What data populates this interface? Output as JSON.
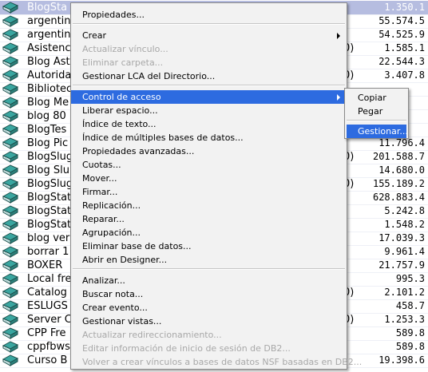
{
  "list": {
    "rows": [
      {
        "name": "BlogSta",
        "extra": "",
        "size": "1.350.1"
      },
      {
        "name": "argentin",
        "extra": "",
        "size": "55.574.5"
      },
      {
        "name": "argentin",
        "extra": "",
        "size": "54.525.9"
      },
      {
        "name": "Asistenc",
        "extra": "0)",
        "size": "1.585.1"
      },
      {
        "name": "Blog Ast",
        "extra": "",
        "size": "22.544.3"
      },
      {
        "name": "Autorida",
        "extra": "0)",
        "size": "3.407.8"
      },
      {
        "name": "Bibliotec",
        "extra": "",
        "size": ""
      },
      {
        "name": "Blog Me",
        "extra": "",
        "size": ""
      },
      {
        "name": "blog 80",
        "extra": "",
        "size": ""
      },
      {
        "name": "BlogTes",
        "extra": "",
        "size": ""
      },
      {
        "name": "Blog Pic",
        "extra": "",
        "size": "11.796.4"
      },
      {
        "name": "BlogSlug",
        "extra": "0)",
        "size": "201.588.7"
      },
      {
        "name": "Blog Slu",
        "extra": "",
        "size": "14.680.0"
      },
      {
        "name": "BlogSlug",
        "extra": "0)",
        "size": "155.189.2"
      },
      {
        "name": "BlogStat",
        "extra": "",
        "size": "628.883.4"
      },
      {
        "name": "BlogStat",
        "extra": "",
        "size": "5.242.8"
      },
      {
        "name": "BlogStat",
        "extra": "",
        "size": "1.548.2"
      },
      {
        "name": "blog ver",
        "extra": "",
        "size": "17.039.3"
      },
      {
        "name": "borrar 1",
        "extra": "",
        "size": "9.961.4"
      },
      {
        "name": "BOXER",
        "extra": "",
        "size": "21.757.9"
      },
      {
        "name": "Local fre",
        "extra": "",
        "size": "995.3"
      },
      {
        "name": "Catalog",
        "extra": "0)",
        "size": "2.101.2"
      },
      {
        "name": "ESLUGS",
        "extra": "",
        "size": "458.7"
      },
      {
        "name": "Server C",
        "extra": "0)",
        "size": "1.253.3"
      },
      {
        "name": "CPP Fre",
        "extra": "",
        "size": "589.8"
      },
      {
        "name": "cppfbws",
        "extra": "",
        "size": "589.8"
      },
      {
        "name": "Curso B",
        "extra": "",
        "size": "19.398.6"
      }
    ]
  },
  "context_menu": {
    "items": [
      {
        "label": "Propiedades...",
        "disabled": false
      },
      {
        "label": "Crear",
        "disabled": false,
        "submenu": true
      },
      {
        "label": "Actualizar vínculo...",
        "disabled": true
      },
      {
        "label": "Eliminar carpeta...",
        "disabled": true
      },
      {
        "label": "Gestionar LCA del Directorio...",
        "disabled": false
      },
      {
        "label": "Control de acceso",
        "disabled": false,
        "submenu": true,
        "highlighted": true
      },
      {
        "label": "Liberar espacio...",
        "disabled": false
      },
      {
        "label": "Índice de texto...",
        "disabled": false
      },
      {
        "label": "Índice de múltiples bases de datos...",
        "disabled": false
      },
      {
        "label": "Propiedades avanzadas...",
        "disabled": false
      },
      {
        "label": "Cuotas...",
        "disabled": false
      },
      {
        "label": "Mover...",
        "disabled": false
      },
      {
        "label": "Firmar...",
        "disabled": false
      },
      {
        "label": "Replicación...",
        "disabled": false
      },
      {
        "label": "Reparar...",
        "disabled": false
      },
      {
        "label": "Agrupación...",
        "disabled": false
      },
      {
        "label": "Eliminar base de datos...",
        "disabled": false
      },
      {
        "label": "Abrir en Designer...",
        "disabled": false
      },
      {
        "label": "Analizar...",
        "disabled": false
      },
      {
        "label": "Buscar nota...",
        "disabled": false
      },
      {
        "label": "Crear evento...",
        "disabled": false
      },
      {
        "label": "Gestionar vistas...",
        "disabled": false
      },
      {
        "label": "Actualizar redireccionamiento...",
        "disabled": true
      },
      {
        "label": "Editar información de inicio de sesión de DB2...",
        "disabled": true
      },
      {
        "label": "Volver a crear vínculos a bases de datos NSF basadas en DB2...",
        "disabled": true
      }
    ]
  },
  "submenu": {
    "items": [
      {
        "label": "Copiar",
        "highlighted": false
      },
      {
        "label": "Pegar",
        "highlighted": false
      },
      {
        "label": "Gestionar...",
        "highlighted": true
      }
    ]
  },
  "colors": {
    "menu_highlight": "#2d6be0",
    "selected_row": "#b6bde0",
    "icon_book": "#3aa6a0"
  }
}
